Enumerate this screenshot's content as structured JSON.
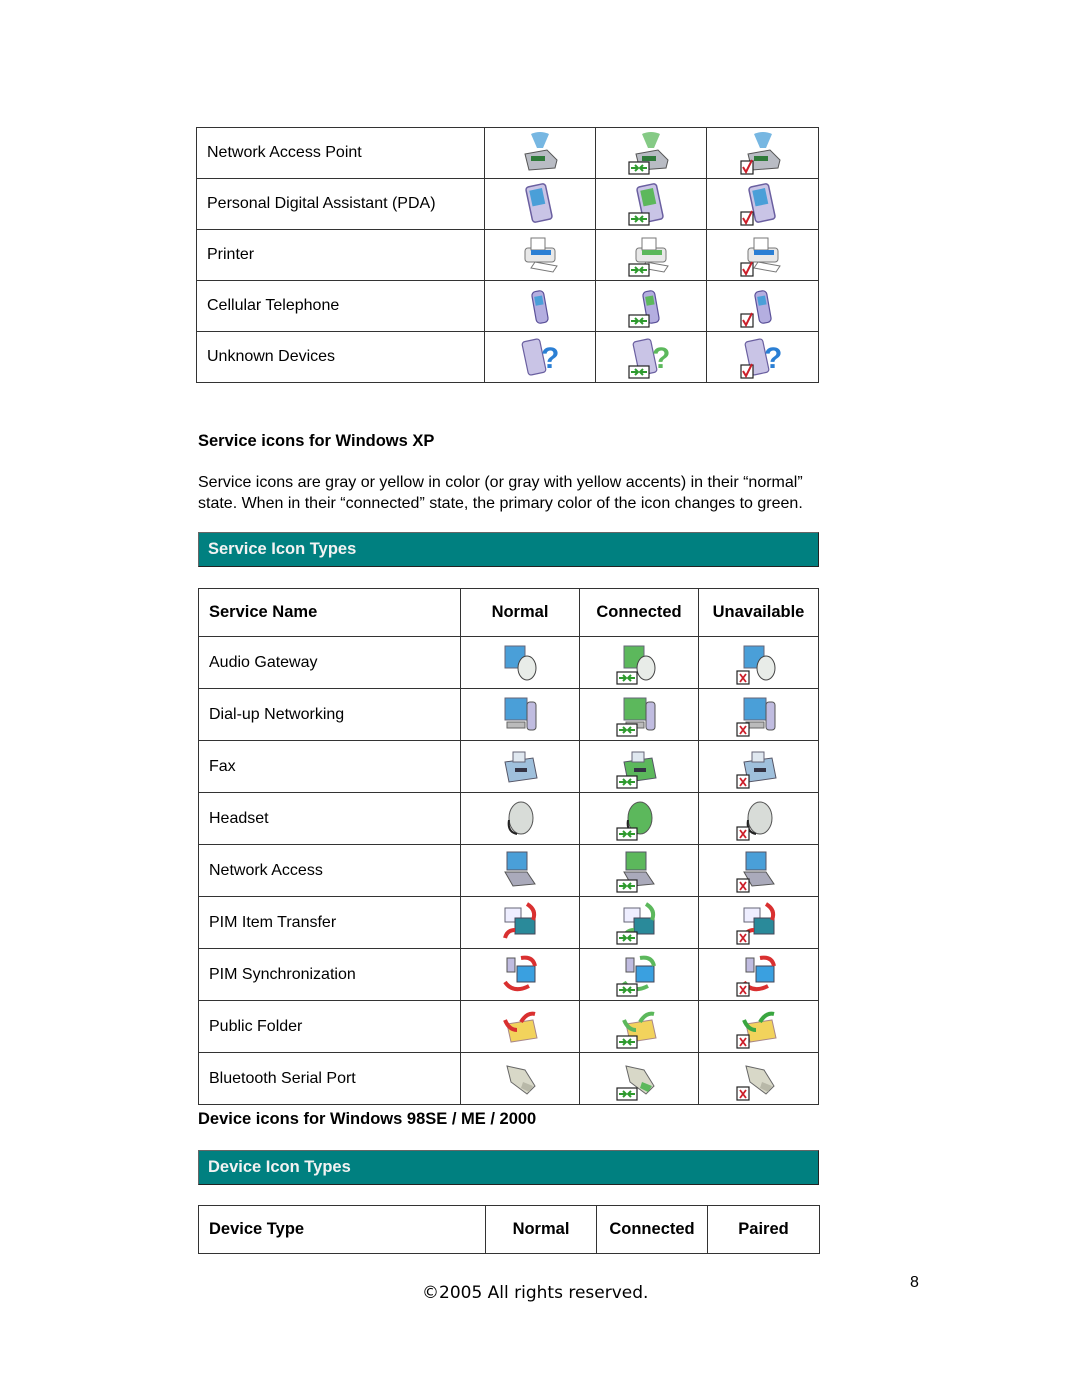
{
  "device_table_xp": {
    "rows": [
      {
        "label": "Network Access Point",
        "icon": "network-access-point",
        "states": [
          "normal",
          "connected",
          "paired"
        ]
      },
      {
        "label": "Personal Digital Assistant (PDA)",
        "icon": "pda",
        "states": [
          "normal",
          "connected",
          "paired"
        ]
      },
      {
        "label": "Printer",
        "icon": "printer",
        "states": [
          "normal",
          "connected",
          "paired"
        ]
      },
      {
        "label": "Cellular Telephone",
        "icon": "cellular-telephone",
        "states": [
          "normal",
          "connected",
          "paired"
        ]
      },
      {
        "label": "Unknown Devices",
        "icon": "unknown-device",
        "states": [
          "normal",
          "connected",
          "paired"
        ]
      }
    ]
  },
  "service_section": {
    "heading": "Service icons for Windows XP",
    "paragraph_line1": "Service icons are gray or yellow in color (or gray with yellow accents) in their “normal”",
    "paragraph_line2": "state. When in their “connected” state, the primary color of the icon changes to green.",
    "bar_title": "Service Icon Types",
    "headers": [
      "Service Name",
      "Normal",
      "Connected",
      "Unavailable"
    ],
    "rows": [
      {
        "label": "Audio Gateway",
        "icon": "audio-gateway"
      },
      {
        "label": "Dial-up Networking",
        "icon": "dial-up-networking"
      },
      {
        "label": "Fax",
        "icon": "fax"
      },
      {
        "label": "Headset",
        "icon": "headset"
      },
      {
        "label": "Network Access",
        "icon": "network-access"
      },
      {
        "label": "PIM Item Transfer",
        "icon": "pim-item-transfer"
      },
      {
        "label": "PIM Synchronization",
        "icon": "pim-synchronization"
      },
      {
        "label": "Public Folder",
        "icon": "public-folder"
      },
      {
        "label": "Bluetooth Serial Port",
        "icon": "serial-port"
      }
    ]
  },
  "device_section_98": {
    "heading": "Device icons for Windows 98SE / ME / 2000",
    "bar_title": "Device Icon Types",
    "headers": [
      "Device Type",
      "Normal",
      "Connected",
      "Paired"
    ]
  },
  "footer": {
    "copyright": "©2005 All rights reserved.",
    "page_number": "8"
  },
  "colors": {
    "teal_bar": "#008080",
    "connected_green": "#2e9a2e",
    "normal_blue": "#4a9fd8",
    "paired_check_red": "#cc1f2a",
    "unavailable_x_red": "#cc1f2a"
  }
}
